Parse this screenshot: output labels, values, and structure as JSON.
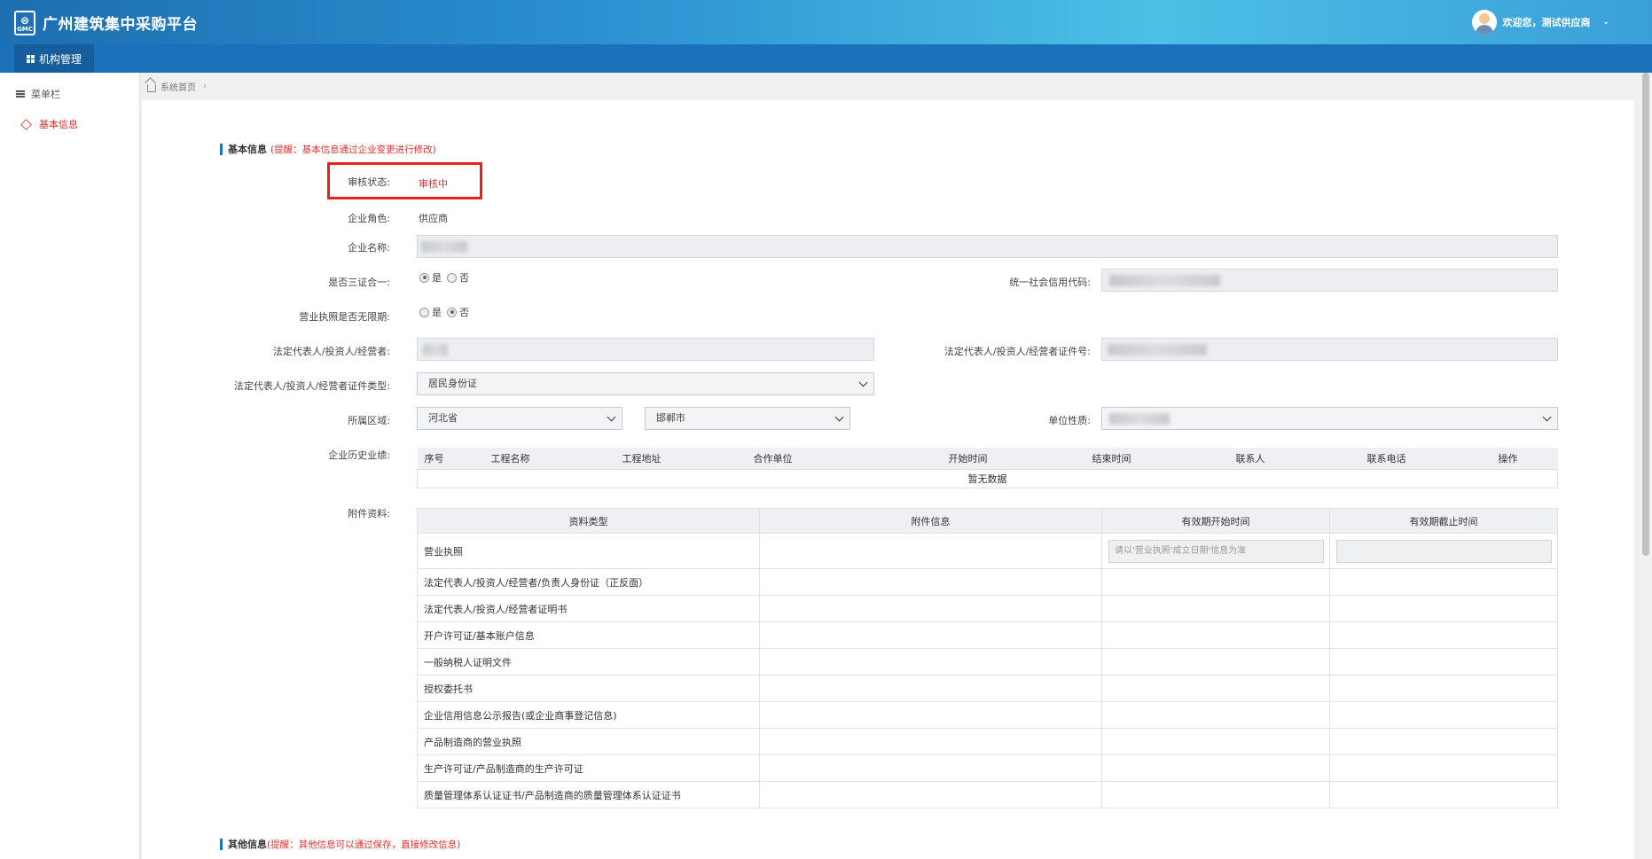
{
  "header": {
    "logo_text": "GMC",
    "title": "广州建筑集中采购平台",
    "welcome": "欢迎您，测试供应商"
  },
  "nav": {
    "tab_label": "机构管理"
  },
  "sidebar": {
    "header": "菜单栏",
    "items": [
      {
        "label": "基本信息",
        "active": true
      }
    ]
  },
  "breadcrumb": {
    "home": "系统首页"
  },
  "basic": {
    "title": "基本信息",
    "hint": "(提醒：基本信息通过企业变更进行修改)",
    "status_label": "审核状态:",
    "status_value": "审核中",
    "role_label": "企业角色:",
    "role_value": "供应商",
    "name_label": "企业名称:",
    "three_in_one_label": "是否三证合一:",
    "three_in_one": {
      "options": [
        "是",
        "否"
      ],
      "selected": "是"
    },
    "credit_code_label": "统一社会信用代码:",
    "license_unlimited_label": "营业执照是否无限期:",
    "license_unlimited": {
      "options": [
        "是",
        "否"
      ],
      "selected": "否"
    },
    "legal_rep_label": "法定代表人/投资人/经营者:",
    "legal_rep_id_label": "法定代表人/投资人/经营者证件号:",
    "legal_rep_id_type_label": "法定代表人/投资人/经营者证件类型:",
    "legal_rep_id_type_value": "居民身份证",
    "region_label": "所属区域:",
    "province_value": "河北省",
    "city_value": "邯郸市",
    "unit_nature_label": "单位性质:",
    "history_label": "企业历史业绩:",
    "attachments_label": "附件资料:"
  },
  "performance_table": {
    "columns": [
      "序号",
      "工程名称",
      "工程地址",
      "合作单位",
      "开始时间",
      "结束时间",
      "联系人",
      "联系电话",
      "操作"
    ],
    "empty_text": "暂无数据"
  },
  "attachments_table": {
    "columns": [
      "资料类型",
      "附件信息",
      "有效期开始时间",
      "有效期截止时间"
    ],
    "first_row_start_placeholder": "请以'营业执照'成立日期'信息为准",
    "rows": [
      "营业执照",
      "法定代表人/投资人/经营者/负责人身份证（正反面）",
      "法定代表人/投资人/经营者证明书",
      "开户许可证/基本账户信息",
      "一般纳税人证明文件",
      "授权委托书",
      "企业信用信息公示报告(或企业商事登记信息)",
      "产品制造商的营业执照",
      "生产许可证/产品制造商的生产许可证",
      "质量管理体系认证证书/产品制造商的质量管理体系认证证书"
    ]
  },
  "other": {
    "title": "其他信息",
    "hint": "(提醒：其他信息可以通过保存，直接修改信息)"
  },
  "colors": {
    "brand_blue": "#1b72bb",
    "alert_red": "#e0312c"
  }
}
